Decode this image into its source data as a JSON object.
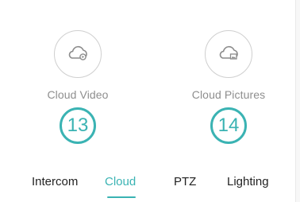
{
  "features": [
    {
      "icon": "cloud-video-icon",
      "label": "Cloud Video",
      "badge": "13"
    },
    {
      "icon": "cloud-pictures-icon",
      "label": "Cloud Pictures",
      "badge": "14"
    }
  ],
  "tabs": [
    {
      "label": "Intercom",
      "active": false
    },
    {
      "label": "Cloud",
      "active": true
    },
    {
      "label": "PTZ",
      "active": false
    },
    {
      "label": "Lighting",
      "active": false
    }
  ],
  "colors": {
    "accent": "#3ab3b3",
    "label_gray": "#8e8e8e",
    "icon_gray": "#8c8c8c",
    "text": "#222222"
  }
}
